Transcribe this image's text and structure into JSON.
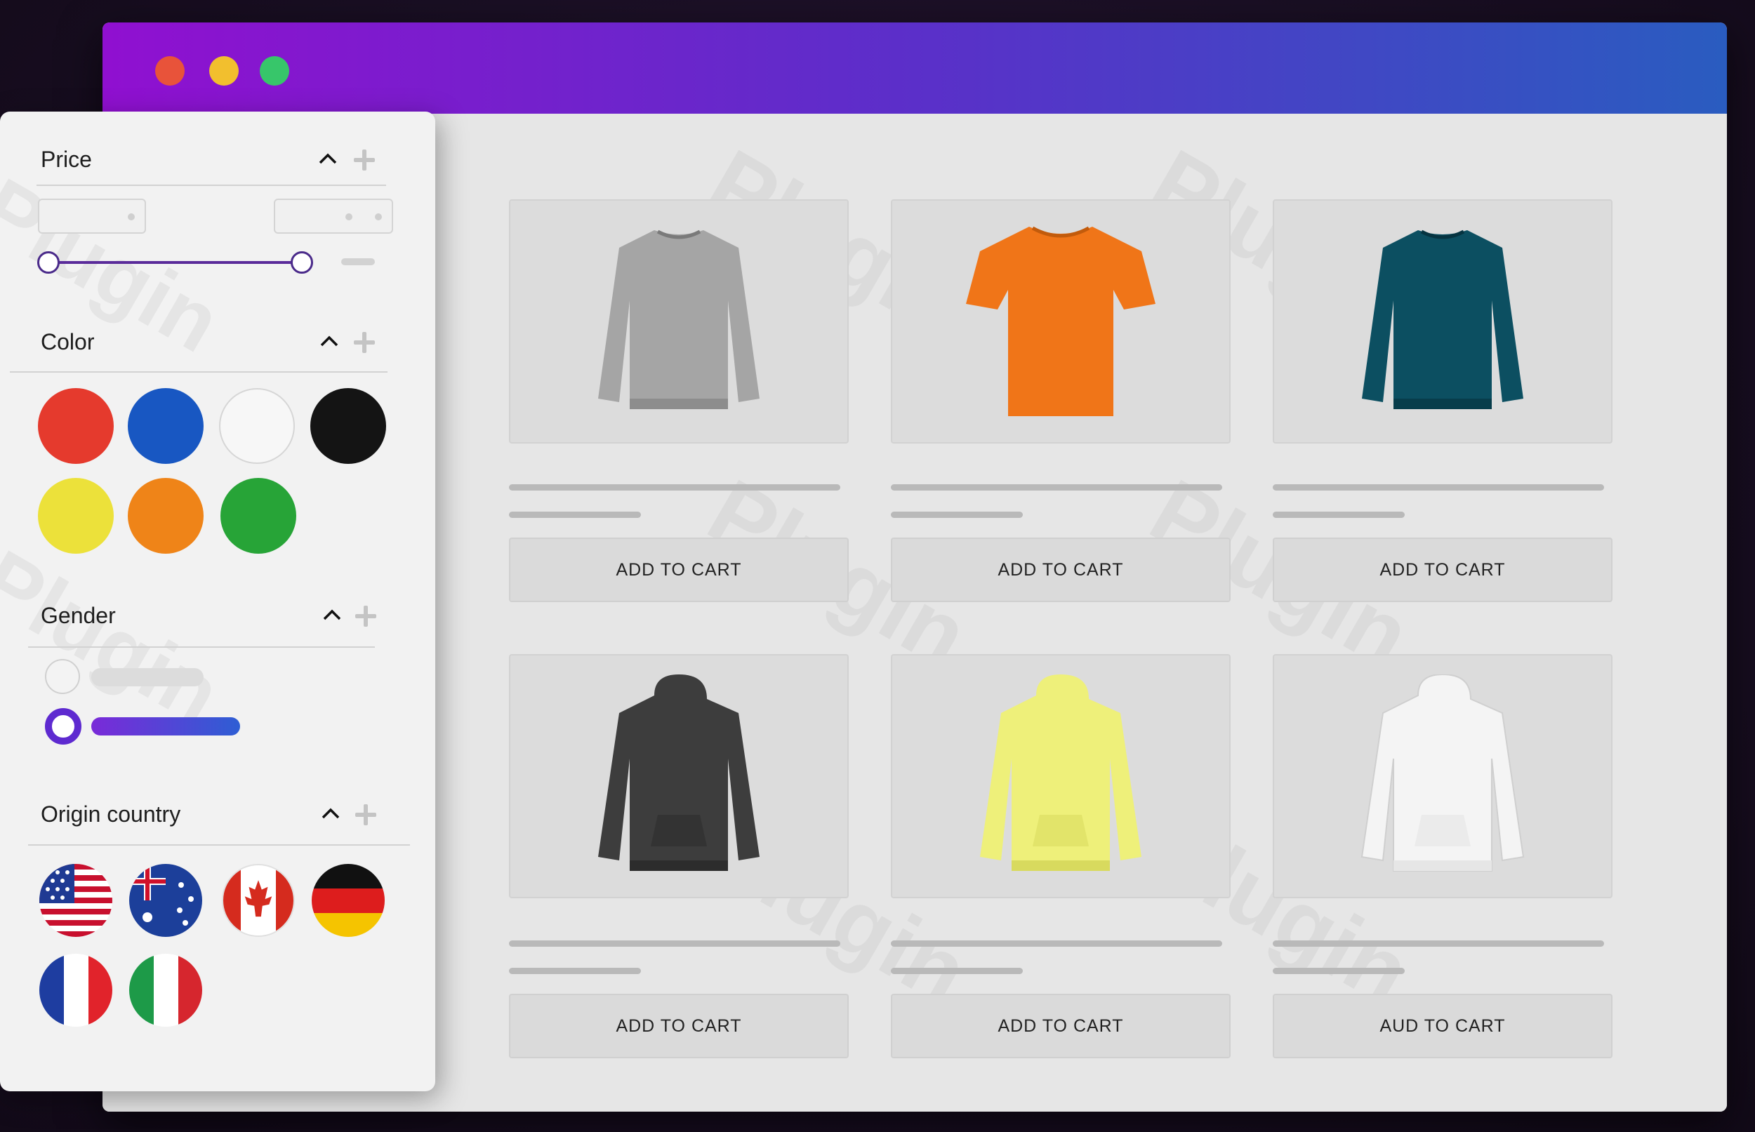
{
  "window": {
    "controls": [
      "close",
      "minimize",
      "maximize"
    ],
    "colors": {
      "close": "#e8533a",
      "minimize": "#f2bf2e",
      "maximize": "#37c66a",
      "titlebar_start": "#9010d0",
      "titlebar_end": "#2a5cc0"
    }
  },
  "watermark": "Plugin",
  "filters": {
    "price": {
      "title": "Price"
    },
    "color": {
      "title": "Color",
      "swatches": [
        {
          "name": "red",
          "hex": "#e53a2d"
        },
        {
          "name": "blue",
          "hex": "#1857c2"
        },
        {
          "name": "white",
          "hex": "#f7f7f7"
        },
        {
          "name": "black",
          "hex": "#141414"
        },
        {
          "name": "yellow",
          "hex": "#ece13a"
        },
        {
          "name": "orange",
          "hex": "#ef8418"
        },
        {
          "name": "green",
          "hex": "#27a437"
        }
      ]
    },
    "gender": {
      "title": "Gender",
      "selected_index": 1
    },
    "origin": {
      "title": "Origin country",
      "flags": [
        "usa",
        "australia",
        "canada",
        "germany",
        "france",
        "italy"
      ]
    }
  },
  "products": [
    {
      "item": "grey-sweatshirt",
      "button": "ADD TO CART"
    },
    {
      "item": "orange-tshirt",
      "button": "ADD TO CART"
    },
    {
      "item": "teal-sweatshirt",
      "button": "ADD TO CART"
    },
    {
      "item": "charcoal-hoodie",
      "button": "ADD TO CART"
    },
    {
      "item": "yellow-hoodie",
      "button": "ADD TO CART"
    },
    {
      "item": "white-hoodie",
      "button": "AUD TO CART"
    }
  ]
}
